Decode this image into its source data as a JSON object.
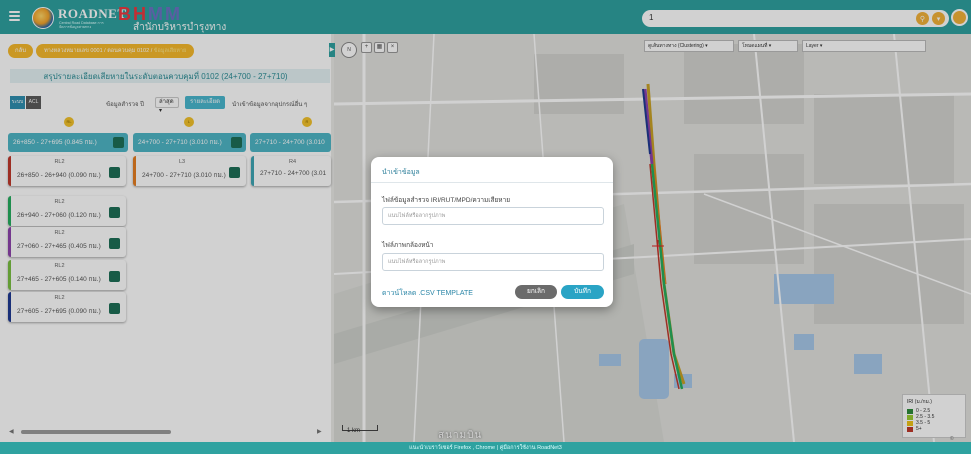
{
  "header": {
    "logo_title": "ROADNET",
    "logo_subtitle": "Central Road Database การจัดการข้อมูลสายทาง",
    "brand_b": "B",
    "brand_h": "H",
    "brand_mm": "MM",
    "brand_sub": "สำนักบริหารบำรุงทาง",
    "search_value": "1",
    "colors": {
      "teal": "#2fa2a0",
      "orange": "#f3b23a",
      "red": "#f0383f"
    }
  },
  "left_panel": {
    "back_label": "กลับ",
    "crumb_path": "ทางหลวงหมายเลข 0001 / ตอนควบคุม 0102 / ",
    "crumb_current": "ข้อมูลเสียหาย",
    "summary_title": "สรุปรายละเอียดเสียหายในระดับตอนควบคุมที่ 0102 (24+700 - 27+710)",
    "toggle_a": "ระบบ",
    "toggle_b": "ACL",
    "latest_label": "ข้อมูลสำรวจ ปี",
    "latest_value": "ล่าสุด",
    "detail_button": "รายละเอียด",
    "import_label": "นำเข้าข้อมูลจากอุปกรณ์อื่น ๆ",
    "lane_markers": [
      "RL",
      "L",
      "R"
    ],
    "segments": [
      {
        "label": "26+850 - 27+695 (0.845 กม.)"
      },
      {
        "label": "24+700 - 27+710 (3.010 กม.)"
      },
      {
        "label": "27+710 - 24+700 (3.010"
      }
    ],
    "cards": [
      {
        "lane": "RL2",
        "range": "26+850 - 26+940 (0.090 กม.)",
        "color": "#c0392b"
      },
      {
        "lane": "RL2",
        "range": "26+940 - 27+060 (0.120 กม.)",
        "color": "#27ae60"
      },
      {
        "lane": "RL2",
        "range": "27+060 - 27+465 (0.405 กม.)",
        "color": "#8e44ad"
      },
      {
        "lane": "RL2",
        "range": "27+465 - 27+605 (0.140 กม.)",
        "color": "#7bc043"
      },
      {
        "lane": "RL2",
        "range": "27+605 - 27+695 (0.090 กม.)",
        "color": "#1f3a93"
      },
      {
        "lane": "L3",
        "range": "24+700 - 27+710 (3.010 กม.)",
        "color": "#e67e22"
      },
      {
        "lane": "R4",
        "range": "27+710 - 24+700 (3.01",
        "color": "#3fa7b5"
      }
    ]
  },
  "map": {
    "top_select_1": "ดูเส้นทางทาง (Clustering)",
    "top_select_2": "โหมดแผนที่",
    "top_select_3": "Layer",
    "compass": "N",
    "scale_label": "1 km",
    "place_label": "สนามบิน",
    "watermark": "© Longdo",
    "legend_title": "IRI (ม./กม.)",
    "legend_items": [
      {
        "label": "0 - 2.5",
        "color": "#2e8b3a"
      },
      {
        "label": "2.5 - 3.5",
        "color": "#9acd32"
      },
      {
        "label": "3.5 - 5",
        "color": "#f0c419"
      },
      {
        "label": "5+",
        "color": "#c0392b"
      }
    ]
  },
  "modal": {
    "title": "นำเข้าข้อมูล",
    "field1_label": "ไฟล์ข้อมูลสำรวจ IRI/RUT/MPD/ความเสียหาย",
    "field1_placeholder": "แนบไฟล์หรือลากรูปภาพ",
    "field2_label": "ไฟล์ภาพกล้องหน้า",
    "field2_placeholder": "แนบไฟล์หรือลากรูปภาพ",
    "download_link": "ดาวน์โหลด .CSV TEMPLATE",
    "cancel_label": "ยกเลิก",
    "save_label": "บันทึก"
  },
  "footer": {
    "text": "แนะนำเบราว์เซอร์ Firefox , Chrome | คู่มือการใช้งาน RoadNet3"
  }
}
